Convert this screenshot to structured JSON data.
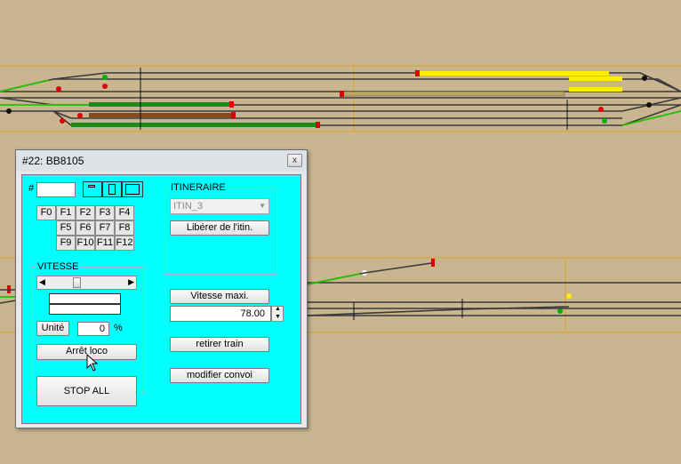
{
  "window": {
    "title": "#22: BB8105",
    "close_label": "x"
  },
  "address": {
    "hash_label": "#",
    "value": ""
  },
  "function_keys": [
    "F0",
    "F1",
    "F2",
    "F3",
    "F4",
    "F5",
    "F6",
    "F7",
    "F8",
    "F9",
    "F10",
    "F11",
    "F12"
  ],
  "speed_group": {
    "label": "VITESSE",
    "unit_button": "Unité",
    "value": "0",
    "percent_label": "%",
    "stop_loco_button": "Arrêt loco"
  },
  "stop_all_button": "STOP ALL",
  "itinerary_group": {
    "label": "ITINERAIRE",
    "selected": "ITIN_3",
    "release_button": "Libérer de l'itin."
  },
  "max_speed": {
    "label": "Vitesse maxi.",
    "value": "78.00"
  },
  "remove_train_button": "retirer train",
  "modify_convoy_button": "modifier convoi",
  "colors": {
    "layout_background": "#c9b691",
    "client_background": "#00ffff",
    "track": "#3a3a3a",
    "signal_red": "#e00000",
    "signal_green": "#00b000",
    "occupied_yellow": "#ffee00",
    "occupied_green": "#1a8a1a",
    "occupied_brown": "#8b4a1e"
  }
}
